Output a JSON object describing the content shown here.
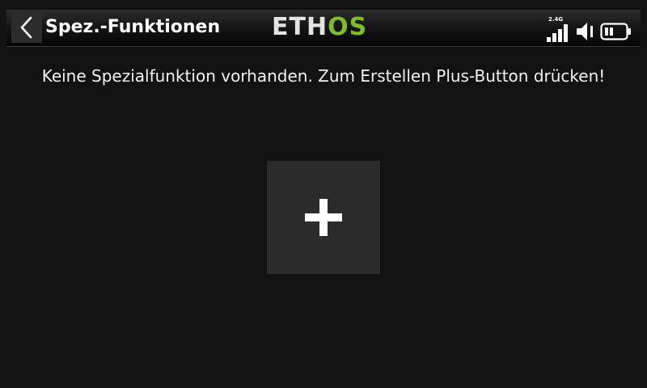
{
  "header": {
    "title": "Spez.-Funktionen",
    "logo_main": "ETH",
    "logo_accent": "OS",
    "rf_band": "2.4G"
  },
  "main": {
    "empty_message": "Keine Spezialfunktion vorhanden. Zum Erstellen Plus-Button drücken!"
  },
  "icons": {
    "back": "chevron-left-icon",
    "signal": "signal-bars-icon",
    "volume": "speaker-icon",
    "battery": "battery-icon",
    "add": "plus-icon"
  },
  "colors": {
    "background": "#121212",
    "accent": "#7dbd2a",
    "button": "#2b2b2b",
    "text": "#ffffff"
  }
}
